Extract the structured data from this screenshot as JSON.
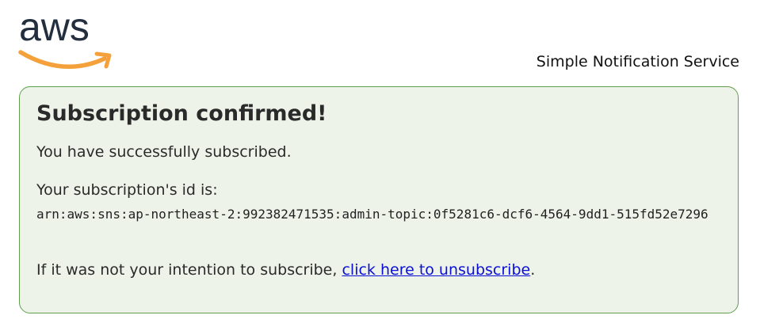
{
  "header": {
    "logo": {
      "text": "aws",
      "text_color": "#232f3e",
      "smile_color": "#f4a13b"
    },
    "service_name": "Simple Notification Service"
  },
  "panel": {
    "title": "Subscription confirmed!",
    "success_message": "You have successfully subscribed.",
    "id_label": "Your subscription's id is:",
    "subscription_arn": "arn:aws:sns:ap-northeast-2:992382471535:admin-topic:0f5281c6-dcf6-4564-9dd1-515fd52e7296",
    "intent_prefix": "If it was not your intention to subscribe, ",
    "unsubscribe_link": "click here to unsubscribe",
    "intent_suffix": ".",
    "border_color": "#5f9f4e",
    "background_color": "#eef3ea",
    "link_color": "#0a0fd6"
  }
}
